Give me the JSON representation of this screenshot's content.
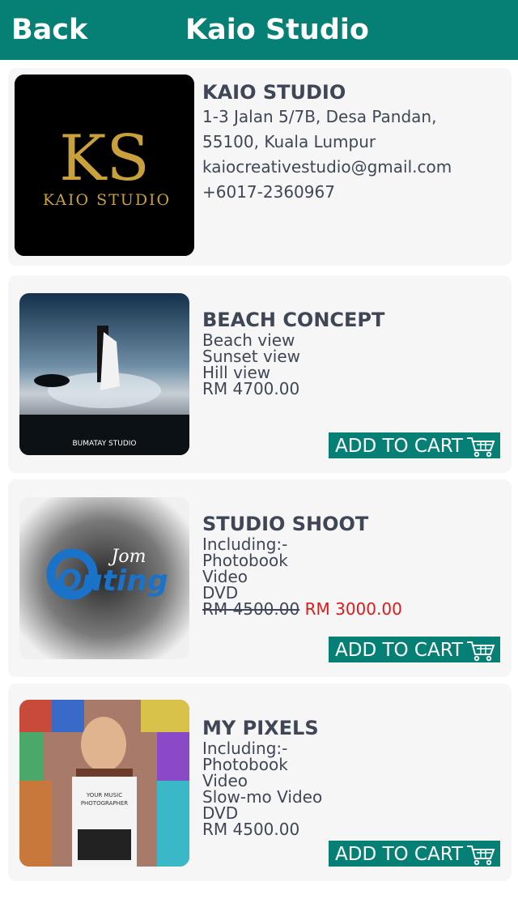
{
  "header": {
    "back_label": "Back",
    "title": "Kaio Studio"
  },
  "studio": {
    "logo_initials": "KS",
    "logo_text": "KAIO STUDIO",
    "name": "KAIO STUDIO",
    "address_line1": "1-3 Jalan 5/7B, Desa Pandan,",
    "address_line2": "55100, Kuala Lumpur",
    "email": "kaiocreativestudio@gmail.com",
    "phone": "+6017-2360967"
  },
  "packages": [
    {
      "name": "BEACH CONCEPT",
      "image_caption": "BUMATAY STUDIO",
      "lines": [
        "Beach view",
        "Sunset view",
        "Hill view"
      ],
      "price": "RM 4700.00",
      "cart_label": "ADD TO CART"
    },
    {
      "name": "STUDIO SHOOT",
      "image_text_1": "Jom",
      "image_text_2": "Outing",
      "lines": [
        "Including:-",
        "Photobook",
        "Video",
        "DVD"
      ],
      "old_price": "RM 4500.00",
      "new_price": "RM 3000.00",
      "cart_label": "ADD TO CART"
    },
    {
      "name": "MY PIXELS",
      "image_text_1": "YOUR MUSIC",
      "image_text_2": "PHOTOGRAPHER",
      "lines": [
        "Including:-",
        "Photobook",
        "Video",
        "Slow-mo Video",
        "DVD"
      ],
      "price": "RM 4500.00",
      "cart_label": "ADD TO CART"
    }
  ],
  "colors": {
    "header": "#067f75",
    "cart_button": "#067f75",
    "sale_price": "#dd1a1a",
    "card_bg": "#f6f6f6",
    "logo_gold": "#c9a13a"
  },
  "icons": {
    "cart": "shopping-cart-icon"
  }
}
